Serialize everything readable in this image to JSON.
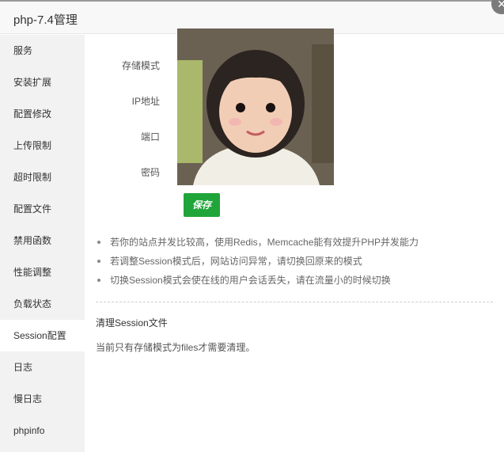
{
  "window": {
    "title": "php-7.4管理",
    "close_glyph": "✕"
  },
  "sidebar": {
    "items": [
      {
        "label": "服务",
        "active": false
      },
      {
        "label": "安装扩展",
        "active": false
      },
      {
        "label": "配置修改",
        "active": false
      },
      {
        "label": "上传限制",
        "active": false
      },
      {
        "label": "超时限制",
        "active": false
      },
      {
        "label": "配置文件",
        "active": false
      },
      {
        "label": "禁用函数",
        "active": false
      },
      {
        "label": "性能调整",
        "active": false
      },
      {
        "label": "负载状态",
        "active": false
      },
      {
        "label": "Session配置",
        "active": true
      },
      {
        "label": "日志",
        "active": false
      },
      {
        "label": "慢日志",
        "active": false
      },
      {
        "label": "phpinfo",
        "active": false
      }
    ]
  },
  "form": {
    "storage_mode_label": "存储模式",
    "ip_label": "IP地址",
    "port_label": "端口",
    "password_label": "密码",
    "save_label": "保存"
  },
  "tips": [
    "若你的站点并发比较高，使用Redis，Memcache能有效提升PHP并发能力",
    "若调整Session模式后，网站访问异常，请切换回原来的模式",
    "切换Session模式会使在线的用户会话丢失，请在流量小的时候切换"
  ],
  "cleanup": {
    "title": "清理Session文件",
    "description": "当前只有存储模式为files才需要清理。"
  },
  "colors": {
    "accent": "#20a53a",
    "sidebar_bg": "#f2f2f2"
  }
}
